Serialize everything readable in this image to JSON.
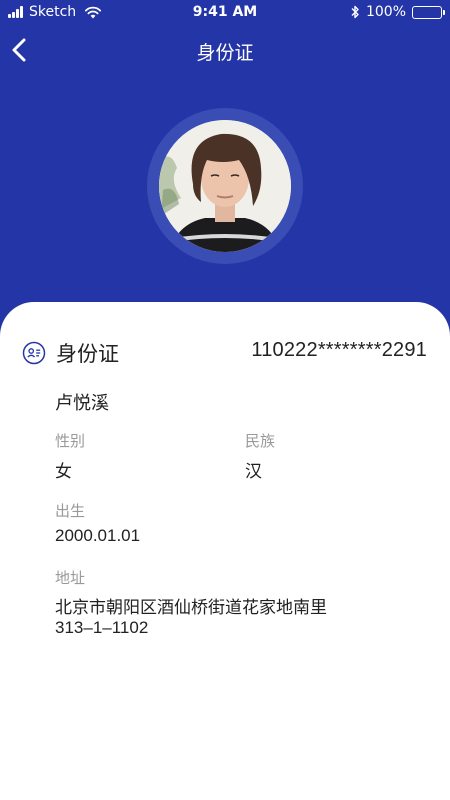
{
  "status_bar": {
    "carrier": "Sketch",
    "time": "9:41 AM",
    "battery": "100%",
    "icons": [
      "signal-icon",
      "wifi-icon",
      "bluetooth-icon",
      "battery-icon"
    ]
  },
  "nav": {
    "title": "身份证",
    "back_icon": "chevron-left-icon"
  },
  "profile": {
    "avatar": "portrait-photo"
  },
  "card": {
    "icon": "id-card-icon",
    "title": "身份证",
    "number": "110222********2291",
    "name": "卢悦溪",
    "gender_label": "性别",
    "gender": "女",
    "ethnicity_label": "民族",
    "ethnicity": "汉",
    "birth_label": "出生",
    "birth": "2000.01.01",
    "address_label": "地址",
    "address_line1": "北京市朝阳区酒仙桥街道花家地南里",
    "address_line2": "313–1–1102"
  },
  "colors": {
    "primary": "#2436a7",
    "ring": "#3a4db5",
    "label": "#9a9a9a",
    "text": "#222222"
  }
}
